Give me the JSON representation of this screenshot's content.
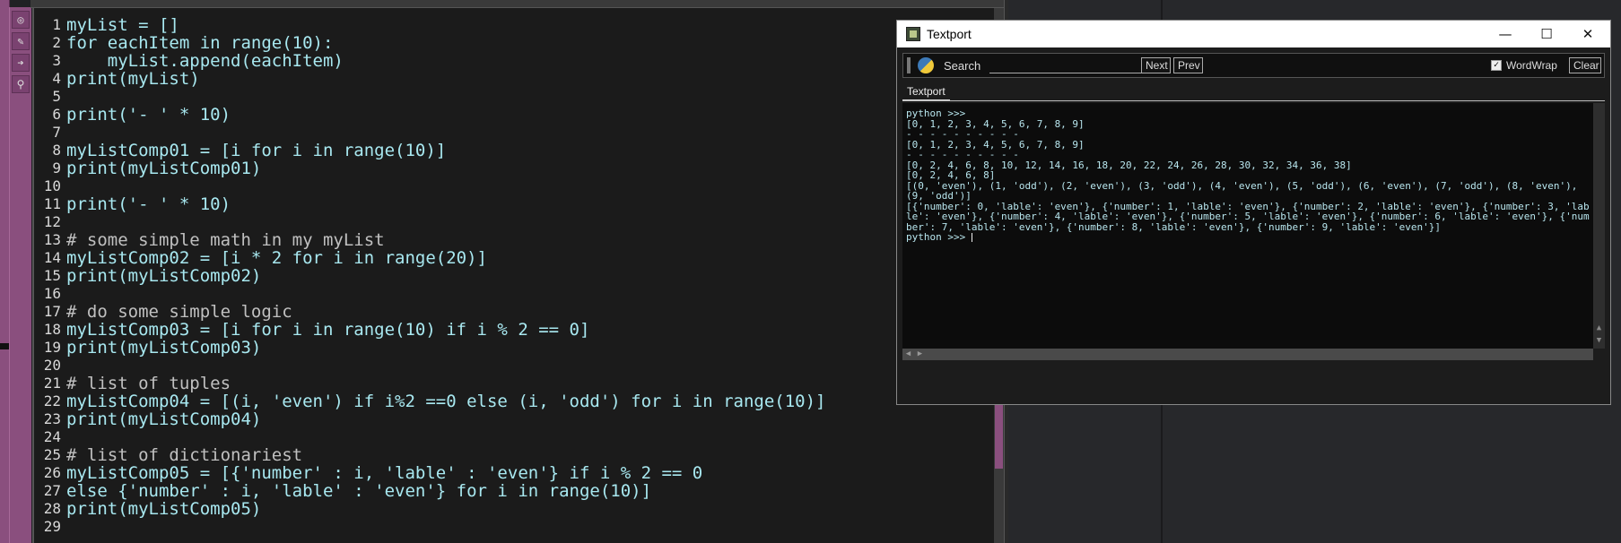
{
  "editor": {
    "line_numbers": [
      "1",
      "2",
      "3",
      "4",
      "5",
      "6",
      "7",
      "8",
      "9",
      "10",
      "11",
      "12",
      "13",
      "14",
      "15",
      "16",
      "17",
      "18",
      "19",
      "20",
      "21",
      "22",
      "23",
      "24",
      "25",
      "26",
      "27",
      "28",
      "29"
    ],
    "lines": [
      "myList = []",
      "for eachItem in range(10):",
      "    myList.append(eachItem)",
      "print(myList)",
      "",
      "print('- ' * 10)",
      "",
      "myListComp01 = [i for i in range(10)]",
      "print(myListComp01)",
      "",
      "print('- ' * 10)",
      "",
      "# some simple math in my myList",
      "myListComp02 = [i * 2 for i in range(20)]",
      "print(myListComp02)",
      "",
      "# do some simple logic",
      "myListComp03 = [i for i in range(10) if i % 2 == 0]",
      "print(myListComp03)",
      "",
      "# list of tuples",
      "myListComp04 = [(i, 'even') if i%2 ==0 else (i, 'odd') for i in range(10)]",
      "print(myListComp04)",
      "",
      "# list of dictionariest",
      "myListComp05 = [{'number' : i, 'lable' : 'even'} if i % 2 == 0",
      "else {'number' : i, 'lable' : 'even'} for i in range(10)]",
      "print(myListComp05)",
      ""
    ]
  },
  "textport": {
    "title": "Textport",
    "window_controls": {
      "minimize": "—",
      "maximize": "☐",
      "close": "✕"
    },
    "toolbar": {
      "search_label": "Search",
      "search_value": "",
      "next_label": "Next",
      "prev_label": "Prev",
      "wordwrap_label": "WordWrap",
      "wordwrap_checked": true,
      "clear_label": "Clear"
    },
    "tab_label": "Textport",
    "output": [
      "python >>>",
      "[0, 1, 2, 3, 4, 5, 6, 7, 8, 9]",
      "- - - - - - - - - -",
      "[0, 1, 2, 3, 4, 5, 6, 7, 8, 9]",
      "- - - - - - - - - -",
      "[0, 2, 4, 6, 8, 10, 12, 14, 16, 18, 20, 22, 24, 26, 28, 30, 32, 34, 36, 38]",
      "[0, 2, 4, 6, 8]",
      "[(0, 'even'), (1, 'odd'), (2, 'even'), (3, 'odd'), (4, 'even'), (5, 'odd'), (6, 'even'), (7, 'odd'), (8, 'even'), (9, 'odd')]",
      "[{'number': 0, 'lable': 'even'}, {'number': 1, 'lable': 'even'}, {'number': 2, 'lable': 'even'}, {'number': 3, 'lable': 'even'}, {'number': 4, 'lable': 'even'}, {'number': 5, 'lable': 'even'}, {'number': 6, 'lable': 'even'}, {'number': 7, 'lable': 'even'}, {'number': 8, 'lable': 'even'}, {'number': 9, 'lable': 'even'}]",
      "python >>> "
    ]
  },
  "colors": {
    "code_text": "#a8e8f0",
    "comment_text": "#c0c0c0",
    "accent_pink": "#8a4f7e",
    "output_text": "#b8e6ee"
  }
}
